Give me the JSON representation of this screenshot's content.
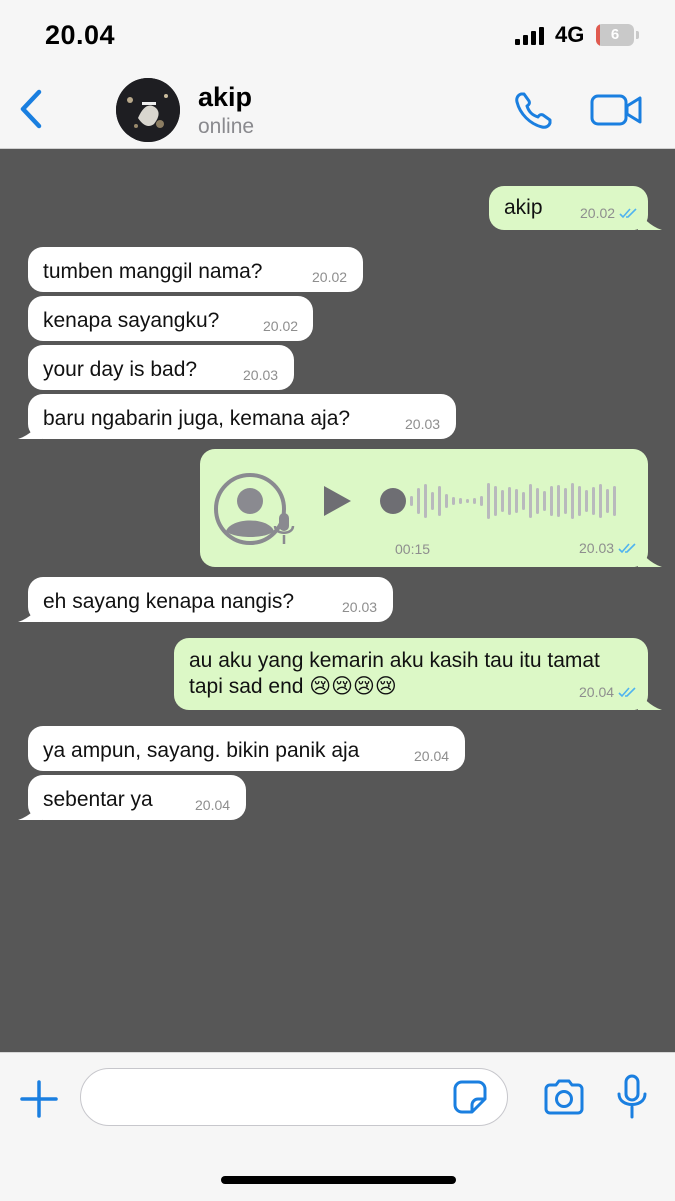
{
  "status_bar": {
    "time": "20.04",
    "network": "4G",
    "battery_level": "6",
    "battery_fraction": 0.1
  },
  "header": {
    "contact_name": "akip",
    "contact_status": "online"
  },
  "messages": [
    {
      "direction": "out",
      "text": "akip",
      "time": "20.02",
      "read": true
    },
    {
      "direction": "in",
      "text": "tumben manggil nama?",
      "time": "20.02"
    },
    {
      "direction": "in",
      "text": "kenapa sayangku?",
      "time": "20.02"
    },
    {
      "direction": "in",
      "text": "your day is bad?",
      "time": "20.03"
    },
    {
      "direction": "in",
      "text": "baru ngabarin juga, kemana aja?",
      "time": "20.03"
    },
    {
      "direction": "out",
      "type": "voice_note",
      "duration": "00:15",
      "time": "20.03",
      "read": true
    },
    {
      "direction": "in",
      "text": "eh sayang kenapa nangis?",
      "time": "20.03"
    },
    {
      "direction": "out",
      "text_line1": "au aku yang kemarin aku kasih tau itu tamat",
      "text_line2": "tapi sad end 😢😢😢😢",
      "time": "20.04",
      "read": true
    },
    {
      "direction": "in",
      "text": "ya ampun, sayang. bikin panik aja",
      "time": "20.04"
    },
    {
      "direction": "in",
      "text": "sebentar ya",
      "time": "20.04"
    }
  ],
  "colors": {
    "accent": "#1a7fe0",
    "outgoing_bubble": "#dcf8c6",
    "incoming_bubble": "#ffffff",
    "chat_background": "#575757",
    "read_ticks": "#4fb3f0"
  },
  "icons": [
    "back-chevron-icon",
    "phone-icon",
    "video-camera-icon",
    "plus-icon",
    "sticker-icon",
    "camera-icon",
    "microphone-icon",
    "play-icon",
    "double-check-icon"
  ]
}
